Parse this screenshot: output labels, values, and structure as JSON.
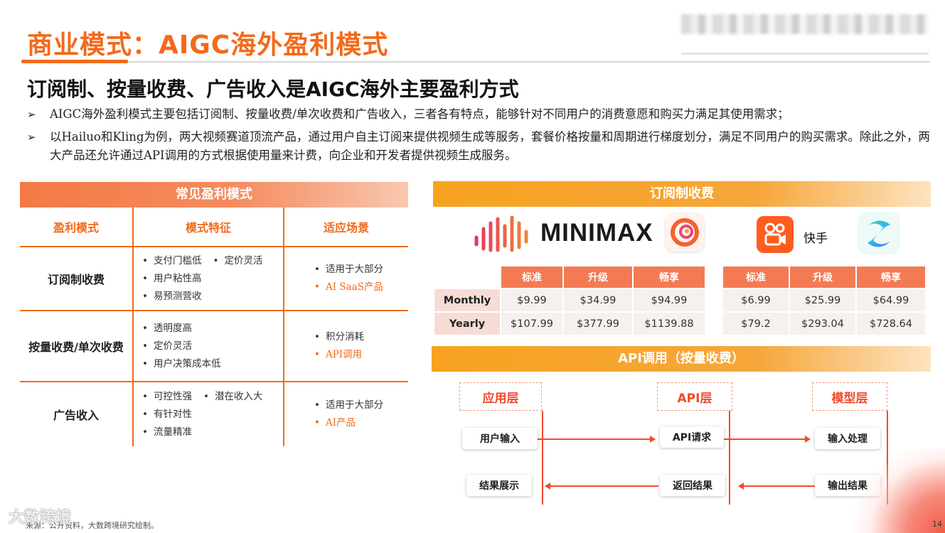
{
  "title": "商业模式：AIGC海外盈利模式",
  "subtitle": "订阅制、按量收费、广告收入是AIGC海外主要盈利方式",
  "bullets": [
    "AIGC海外盈利模式主要包括订阅制、按量收费/单次收费和广告收入，三者各有特点，能够针对不同用户的消费意愿和购买力满足其使用需求；",
    "以Hailuo和Kling为例，两大视频赛道顶流产品，通过用户自主订阅来提供视频生成等服务，套餐价格按量和周期进行梯度划分，满足不同用户的购买需求。除此之外，两大产品还允许通过API调用的方式根据使用量来计费，向企业和开发者提供视频生成服务。"
  ],
  "left_table": {
    "title": "常见盈利模式",
    "headers": [
      "盈利模式",
      "模式特征",
      "适应场景"
    ],
    "rows": [
      {
        "model": "订阅制收费",
        "features": [
          [
            "支付门槛低",
            "定价灵活"
          ],
          [
            "用户粘性高"
          ],
          [
            "易预测营收"
          ]
        ],
        "scene": "适用于大部分",
        "scene_hl": "AI SaaS产品"
      },
      {
        "model": "按量收费/单次收费",
        "features": [
          [
            "透明度高"
          ],
          [
            "定价灵活"
          ],
          [
            "用户决策成本低"
          ]
        ],
        "scene": "积分消耗",
        "scene_hl": "API调用"
      },
      {
        "model": "广告收入",
        "features": [
          [
            "可控性强",
            "潜在收入大"
          ],
          [
            "有针对性"
          ],
          [
            "流量精准"
          ]
        ],
        "scene": "适用于大部分",
        "scene_hl": "AI产品"
      }
    ]
  },
  "subscription": {
    "title": "订阅制收费",
    "minimax_logo_text": "MINIMAX",
    "kuaishou_text": "快手",
    "row_labels": [
      "Monthly",
      "Yearly"
    ],
    "minimax": {
      "tiers": [
        "标准",
        "升级",
        "畅享"
      ],
      "monthly": [
        "$9.99",
        "$34.99",
        "$94.99"
      ],
      "yearly": [
        "$107.99",
        "$377.99",
        "$1139.88"
      ]
    },
    "kling": {
      "tiers": [
        "标准",
        "升级",
        "畅享"
      ],
      "monthly": [
        "$6.99",
        "$25.99",
        "$64.99"
      ],
      "yearly": [
        "$79.2",
        "$293.04",
        "$728.64"
      ]
    }
  },
  "api": {
    "title": "API调用（按量收费）",
    "layers": [
      "应用层",
      "API层",
      "模型层"
    ],
    "forward": [
      "用户输入",
      "API请求",
      "输入处理"
    ],
    "backward": [
      "结果展示",
      "返回结果",
      "输出结果"
    ]
  },
  "footer": {
    "source": "来源：公开资料，大数跨境研究绘制。",
    "watermark": "大数跨境",
    "page": "14"
  },
  "colors": {
    "accent": "#f26a1b",
    "table_header": "#f47a54",
    "banner": "#f7a320",
    "flow": "#f04a2a"
  }
}
